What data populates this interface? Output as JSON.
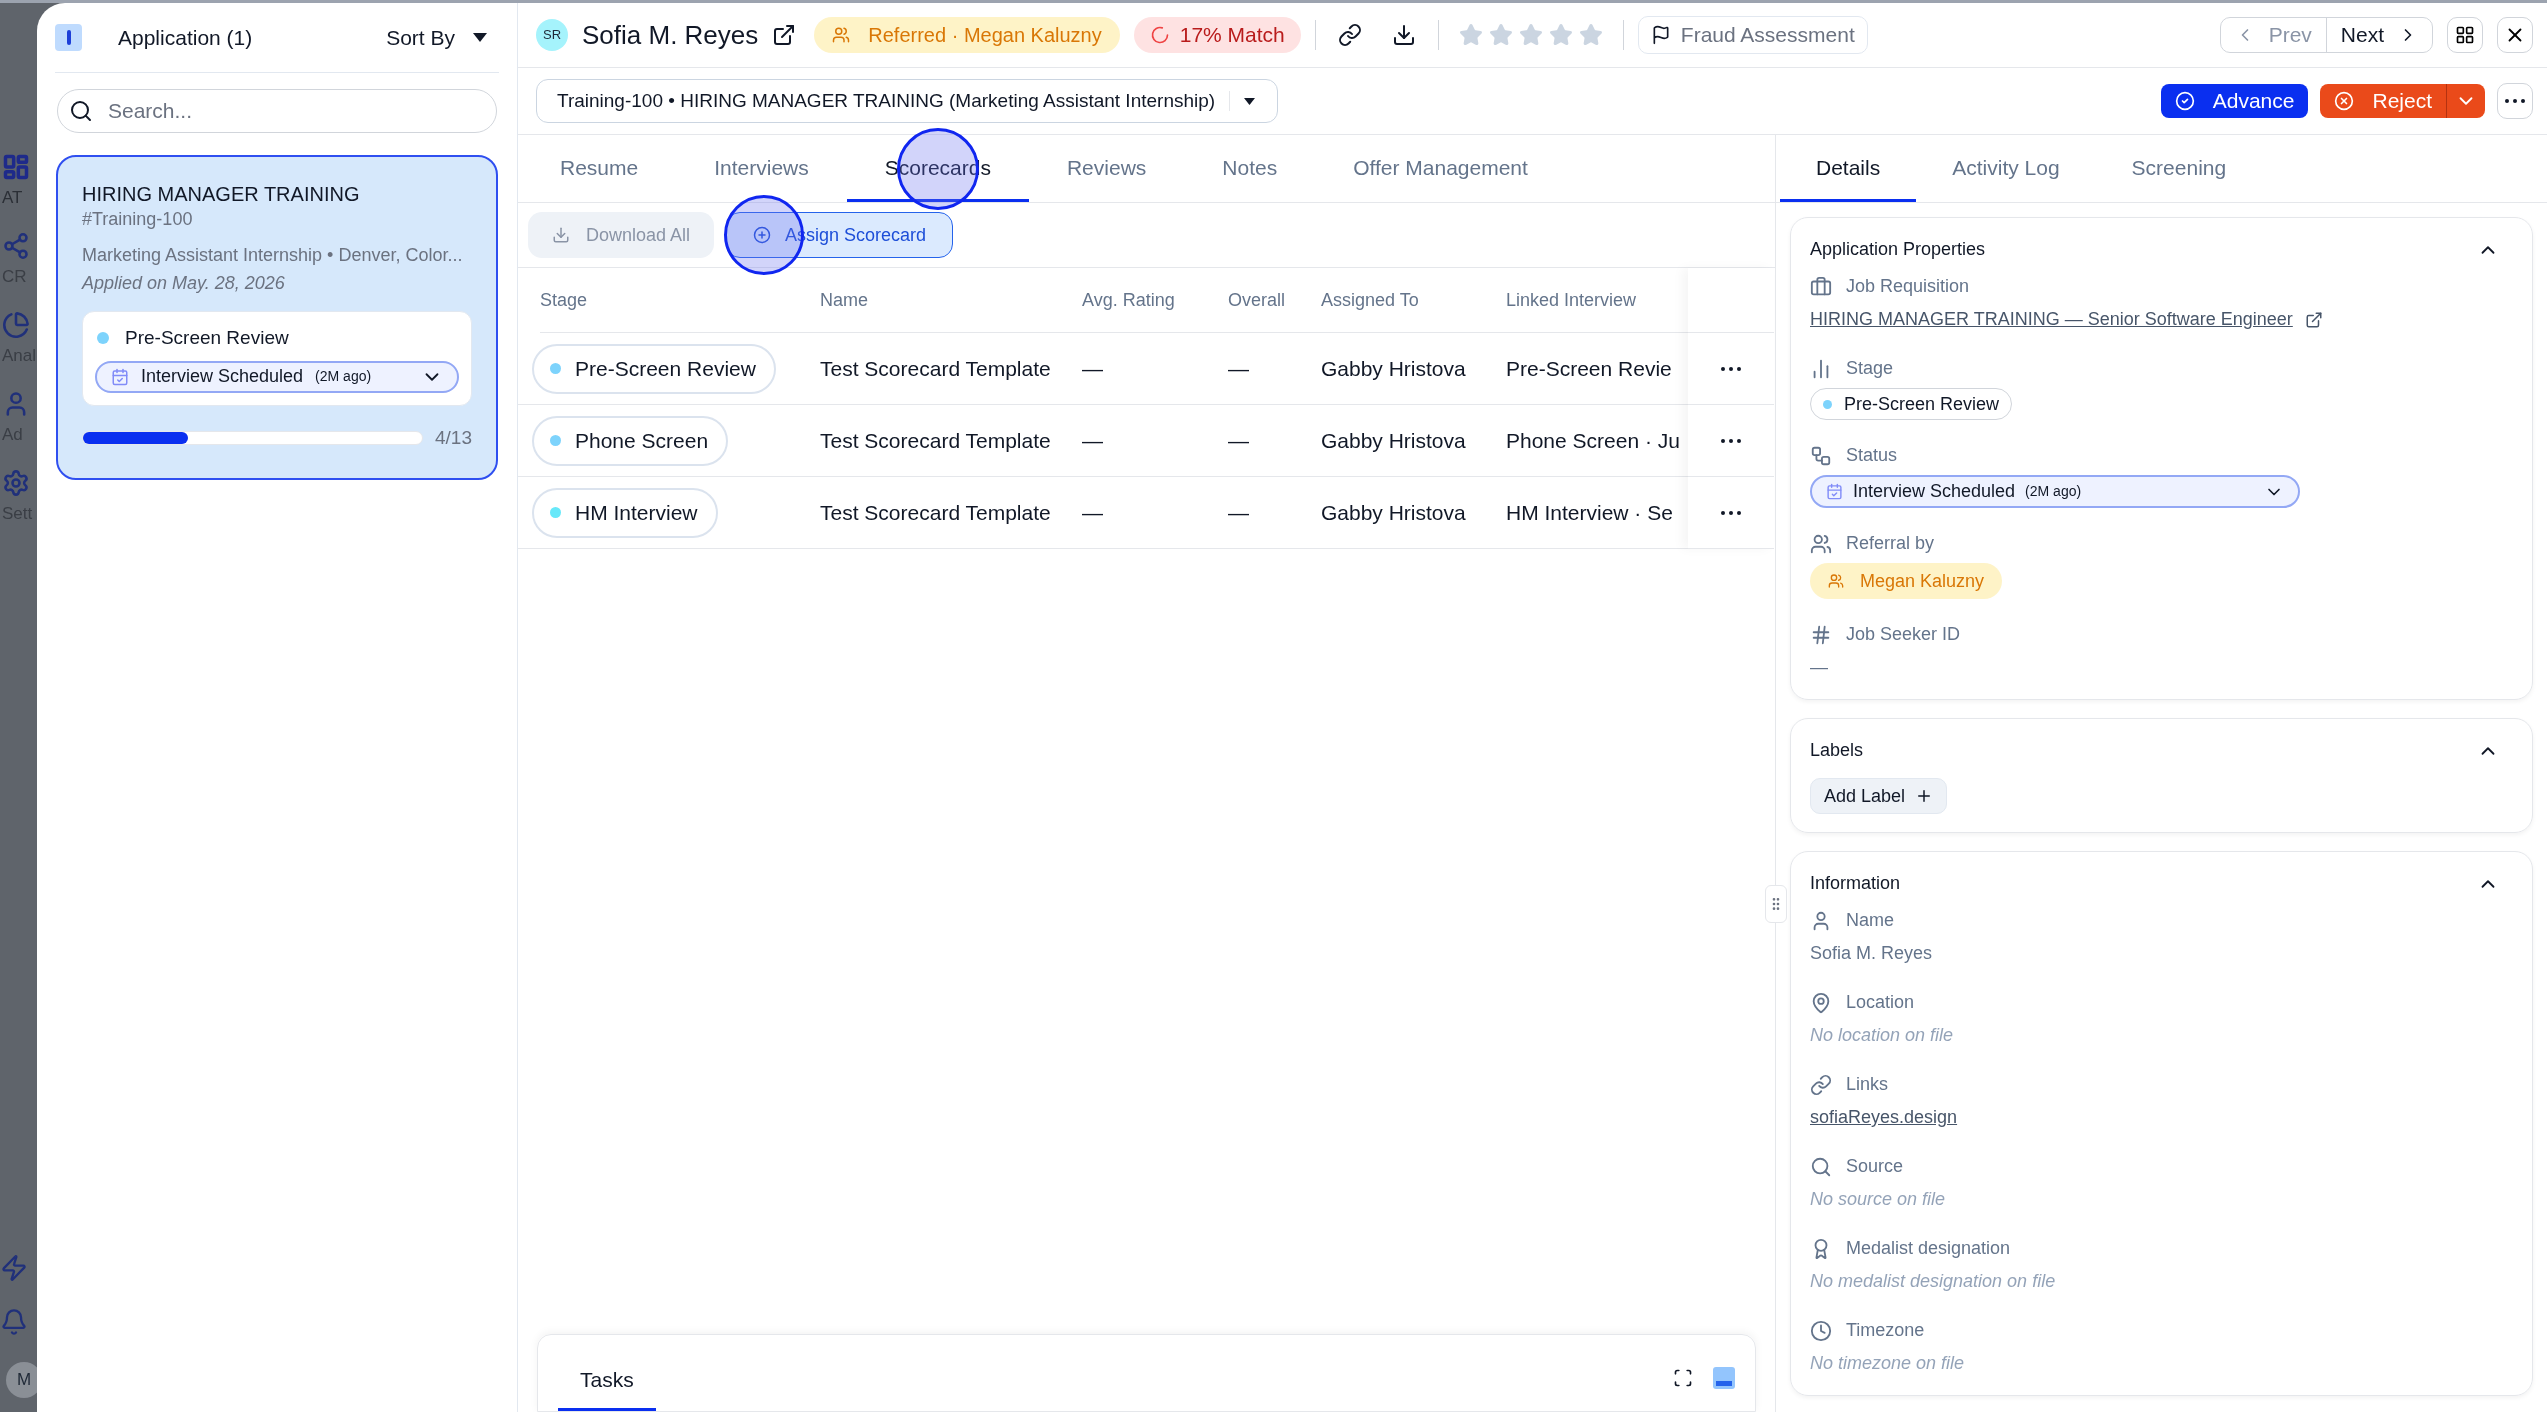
{
  "rail": {
    "items": [
      {
        "label": "AT",
        "selected": true
      },
      {
        "label": "CR",
        "selected": false
      },
      {
        "label": "Anal",
        "selected": false
      },
      {
        "label": "Ad",
        "selected": false
      },
      {
        "label": "Sett",
        "selected": false
      }
    ],
    "avatar": "M"
  },
  "sidebar": {
    "title": "Application (1)",
    "sort": "Sort By",
    "search": {
      "placeholder": "Search..."
    },
    "cards": [
      {
        "title": "HIRING MANAGER TRAINING",
        "code": "#Training-100",
        "subtitle": "Marketing Assistant Internship • Denver, Color...",
        "applied": "Applied on May. 28, 2026",
        "stage": "Pre-Screen Review",
        "color": "#7dd3fc",
        "status": "Interview Scheduled",
        "status_age": "(2M ago)",
        "level": 0.31,
        "progress": "4/13",
        "selected": true
      }
    ]
  },
  "candidate": {
    "initials": "SR",
    "name": "Sofia M. Reyes",
    "referral": "Referred · Megan Kaluzny",
    "match": "17% Match",
    "stars": 0,
    "fraud": "Fraud Assessment"
  },
  "nav": {
    "prev": {
      "label": "Prev",
      "disabled": true
    },
    "next": {
      "label": "Next",
      "disabled": false
    }
  },
  "job_selector": "Training-100 • HIRING MANAGER TRAINING (Marketing Assistant Internship)",
  "actions": {
    "advance": "Advance",
    "reject": "Reject"
  },
  "tabs": [
    {
      "label": "Resume",
      "selected": false
    },
    {
      "label": "Interviews",
      "selected": false
    },
    {
      "label": "Scorecards",
      "selected": true
    },
    {
      "label": "Reviews",
      "selected": false
    },
    {
      "label": "Notes",
      "selected": false
    },
    {
      "label": "Offer Management",
      "selected": false
    }
  ],
  "toolbar": {
    "download_all": {
      "label": "Download All",
      "disabled": true
    },
    "assign": {
      "label": "Assign Scorecard"
    }
  },
  "table": {
    "columns": [
      "Stage",
      "Name",
      "Avg. Rating",
      "Overall",
      "Assigned To",
      "Linked Interview"
    ],
    "rows": [
      {
        "stage": "Pre-Screen Review",
        "color": "#7dd3fc",
        "name": "Test Scorecard Template",
        "avg": "—",
        "overall": "—",
        "assigned": "Gabby Hristova",
        "linked": "Pre-Screen Revie"
      },
      {
        "stage": "Phone Screen",
        "color": "#7dd3fc",
        "name": "Test Scorecard Template",
        "avg": "—",
        "overall": "—",
        "assigned": "Gabby Hristova",
        "linked": "Phone Screen · Ju"
      },
      {
        "stage": "HM Interview",
        "color": "#67e8f9",
        "name": "Test Scorecard Template",
        "avg": "—",
        "overall": "—",
        "assigned": "Gabby Hristova",
        "linked": "HM Interview · Se"
      }
    ]
  },
  "right_tabs": [
    {
      "label": "Details",
      "selected": true
    },
    {
      "label": "Activity Log",
      "selected": false
    },
    {
      "label": "Screening",
      "selected": false
    }
  ],
  "sections": [
    {
      "kind": "fields",
      "title": "Application Properties",
      "expanded": true,
      "fields": [
        {
          "label": "Job Requisition",
          "kind": "link",
          "value": "HIRING MANAGER TRAINING — Senior Software Engineer"
        },
        {
          "label": "Stage",
          "kind": "stage",
          "value": "Pre-Screen Review",
          "color": "#7dd3fc"
        },
        {
          "label": "Status",
          "kind": "status",
          "value": "Interview Scheduled",
          "age": "(2M ago)"
        },
        {
          "label": "Referral by",
          "kind": "referral",
          "value": "Megan Kaluzny"
        },
        {
          "label": "Job Seeker ID",
          "kind": "text",
          "value": "—"
        }
      ]
    },
    {
      "kind": "labels",
      "title": "Labels",
      "expanded": true,
      "button": "Add Label"
    },
    {
      "kind": "fields",
      "title": "Information",
      "expanded": true,
      "fields": [
        {
          "label": "Name",
          "kind": "text",
          "value": "Sofia M. Reyes"
        },
        {
          "label": "Location",
          "kind": "empty",
          "value": "No location on file"
        },
        {
          "label": "Links",
          "kind": "url",
          "value": "sofiaReyes.design"
        },
        {
          "label": "Source",
          "kind": "empty",
          "value": "No source on file"
        },
        {
          "label": "Medalist designation",
          "kind": "empty",
          "value": "No medalist designation on file"
        },
        {
          "label": "Timezone",
          "kind": "empty",
          "value": "No timezone on file"
        }
      ]
    }
  ],
  "tasks": {
    "tabs": [
      {
        "label": "Tasks",
        "selected": true
      }
    ]
  }
}
